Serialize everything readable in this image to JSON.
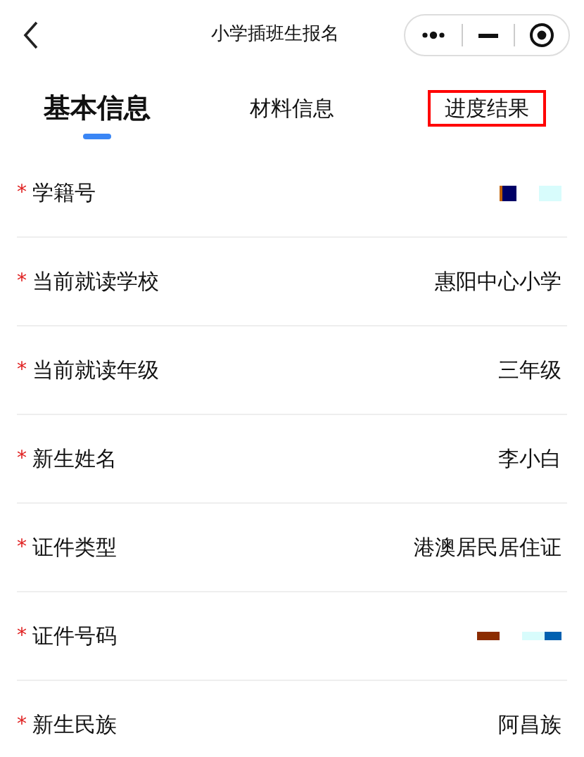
{
  "header": {
    "title": "小学插班生报名"
  },
  "tabs": [
    {
      "label": "基本信息",
      "selected": true,
      "highlighted": false
    },
    {
      "label": "材料信息",
      "selected": false,
      "highlighted": false
    },
    {
      "label": "进度结果",
      "selected": false,
      "highlighted": true
    }
  ],
  "fields": [
    {
      "mark": "*",
      "label": "学籍号",
      "kind": "masked"
    },
    {
      "mark": "*",
      "label": "当前就读学校",
      "kind": "text",
      "value": "惠阳中心小学"
    },
    {
      "mark": "*",
      "label": "当前就读年级",
      "kind": "text",
      "value": "三年级"
    },
    {
      "mark": "*",
      "label": "新生姓名",
      "kind": "text",
      "value": "李小白"
    },
    {
      "mark": "*",
      "label": "证件类型",
      "kind": "text",
      "value": "港澳居民居住证"
    },
    {
      "mark": "*",
      "label": "证件号码",
      "kind": "masked"
    },
    {
      "mark": "*",
      "label": "新生民族",
      "kind": "text",
      "value": "阿昌族"
    }
  ]
}
